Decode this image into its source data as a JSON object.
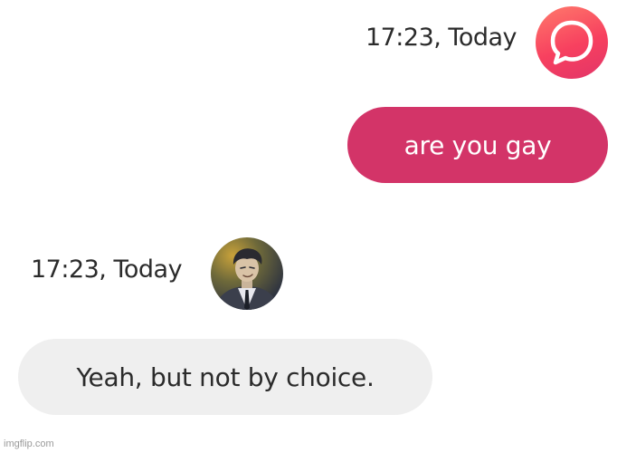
{
  "conversation": {
    "sent": {
      "timestamp": "17:23, Today",
      "message": "are you gay",
      "avatar_icon": "chat-bubble-icon",
      "bubble_color": "#d33468"
    },
    "received": {
      "timestamp": "17:23, Today",
      "message": "Yeah, but not by choice.",
      "avatar_icon": "user-portrait",
      "bubble_color": "#efefef"
    }
  },
  "watermark": "imgflip.com"
}
